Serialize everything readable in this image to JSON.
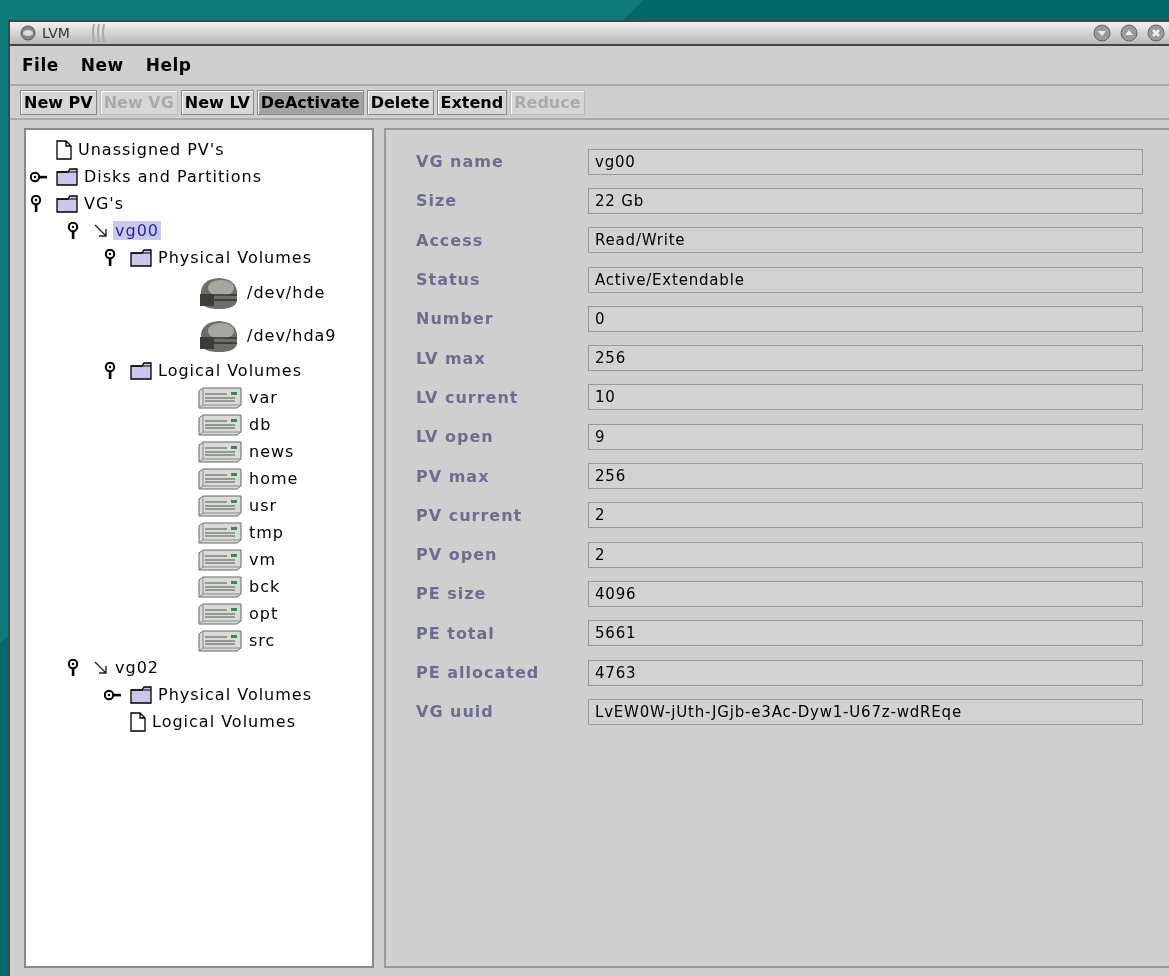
{
  "window": {
    "title": "LVM"
  },
  "menu": [
    "File",
    "New",
    "Help"
  ],
  "toolbar": [
    {
      "label": "New PV",
      "disabled": false,
      "pressed": false
    },
    {
      "label": "New VG",
      "disabled": true,
      "pressed": false
    },
    {
      "label": "New LV",
      "disabled": false,
      "pressed": false
    },
    {
      "label": "DeActivate",
      "disabled": false,
      "pressed": true
    },
    {
      "label": "Delete",
      "disabled": false,
      "pressed": false
    },
    {
      "label": "Extend",
      "disabled": false,
      "pressed": false
    },
    {
      "label": "Reduce",
      "disabled": true,
      "pressed": false
    }
  ],
  "tree": [
    {
      "label": "Unassigned PV's",
      "kind": "page",
      "selected": false
    },
    {
      "label": "Disks and Partitions",
      "kind": "folder",
      "expanded": false,
      "selected": false
    },
    {
      "label": "VG's",
      "kind": "folder",
      "expanded": true,
      "selected": false,
      "children": [
        {
          "label": "vg00",
          "kind": "vg",
          "expanded": true,
          "selected": true,
          "children": [
            {
              "label": "Physical Volumes",
              "kind": "folder",
              "expanded": true,
              "selected": false,
              "children": [
                {
                  "label": "/dev/hde",
                  "kind": "disk",
                  "selected": false
                },
                {
                  "label": "/dev/hda9",
                  "kind": "disk",
                  "selected": false
                }
              ]
            },
            {
              "label": "Logical Volumes",
              "kind": "folder",
              "expanded": true,
              "selected": false,
              "children": [
                {
                  "label": "var",
                  "kind": "lv",
                  "selected": false
                },
                {
                  "label": "db",
                  "kind": "lv",
                  "selected": false
                },
                {
                  "label": "news",
                  "kind": "lv",
                  "selected": false
                },
                {
                  "label": "home",
                  "kind": "lv",
                  "selected": false
                },
                {
                  "label": "usr",
                  "kind": "lv",
                  "selected": false
                },
                {
                  "label": "tmp",
                  "kind": "lv",
                  "selected": false
                },
                {
                  "label": "vm",
                  "kind": "lv",
                  "selected": false
                },
                {
                  "label": "bck",
                  "kind": "lv",
                  "selected": false
                },
                {
                  "label": "opt",
                  "kind": "lv",
                  "selected": false
                },
                {
                  "label": "src",
                  "kind": "lv",
                  "selected": false
                }
              ]
            }
          ]
        },
        {
          "label": "vg02",
          "kind": "vg",
          "expanded": true,
          "selected": false,
          "children": [
            {
              "label": "Physical Volumes",
              "kind": "folder",
              "expanded": false,
              "selected": false
            },
            {
              "label": "Logical Volumes",
              "kind": "page",
              "selected": false
            }
          ]
        }
      ]
    }
  ],
  "properties": [
    {
      "label": "VG name",
      "value": "vg00"
    },
    {
      "label": "Size",
      "value": "22 Gb"
    },
    {
      "label": "Access",
      "value": "Read/Write"
    },
    {
      "label": "Status",
      "value": "Active/Extendable"
    },
    {
      "label": "Number",
      "value": "0"
    },
    {
      "label": "LV max",
      "value": "256"
    },
    {
      "label": "LV current",
      "value": "10"
    },
    {
      "label": "LV open",
      "value": "9"
    },
    {
      "label": "PV max",
      "value": "256"
    },
    {
      "label": "PV current",
      "value": "2"
    },
    {
      "label": "PV open",
      "value": "2"
    },
    {
      "label": "PE size",
      "value": "4096"
    },
    {
      "label": "PE total",
      "value": "5661"
    },
    {
      "label": "PE allocated",
      "value": "4763"
    },
    {
      "label": "VG uuid",
      "value": "LvEW0W-jUth-JGjb-e3Ac-Dyw1-U67z-wdREqe"
    }
  ]
}
